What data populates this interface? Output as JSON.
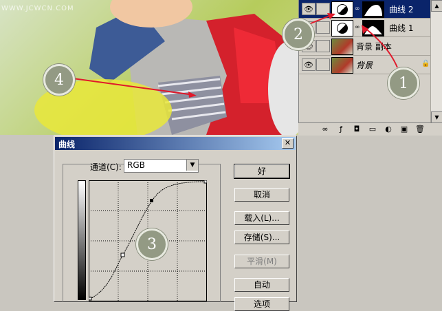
{
  "watermark": "WWW.JCWCN.COM",
  "markers": [
    "1",
    "2",
    "3",
    "4"
  ],
  "layers": [
    {
      "name": "曲线 2",
      "selected": true
    },
    {
      "name": "曲线 1",
      "selected": false
    },
    {
      "name": "背景 副本",
      "selected": false
    },
    {
      "name": "背景",
      "selected": false
    }
  ],
  "dialog": {
    "title": "曲线",
    "channel_label": "通道(C):",
    "channel_value": "RGB",
    "buttons": {
      "ok": "好",
      "cancel": "取消",
      "load": "载入(L)...",
      "save": "存储(S)...",
      "smooth": "平滑(M)",
      "auto": "自动",
      "options": "选项"
    }
  },
  "colors": {
    "accent": "#0a246a",
    "arrow": "#e0192b"
  }
}
